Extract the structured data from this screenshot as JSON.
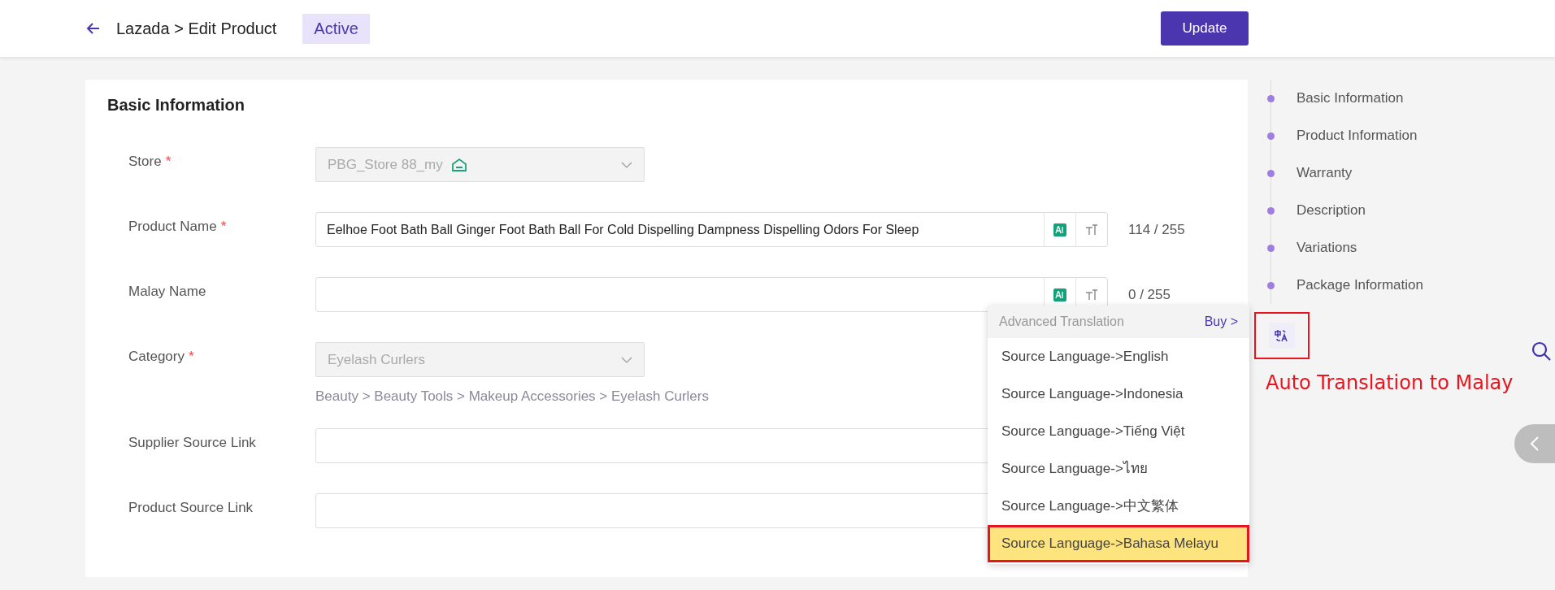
{
  "header": {
    "breadcrumb": "Lazada > Edit Product",
    "status": "Active",
    "update_button": "Update"
  },
  "section": {
    "title": "Basic Information",
    "fields": [
      {
        "kind": "select",
        "label": "Store",
        "required_mark": "*",
        "value": "PBG_Store 88_my",
        "store_icon": true
      },
      {
        "kind": "text",
        "label": "Product Name",
        "required_mark": "*",
        "value": "Eelhoe Foot Bath Ball Ginger Foot Bath Ball For Cold Dispelling Dampness Dispelling Odors For Sleep",
        "counter": "114 / 255"
      },
      {
        "kind": "text",
        "label": "Malay Name",
        "counter": "0 / 255"
      },
      {
        "kind": "select",
        "label": "Category",
        "required_mark": "*",
        "value": "Eyelash Curlers",
        "hint": "Beauty > Beauty Tools > Makeup Accessories > Eyelash Curlers"
      },
      {
        "kind": "link",
        "label": "Supplier Source Link"
      },
      {
        "kind": "link",
        "label": "Product Source Link"
      }
    ]
  },
  "translation_menu": {
    "open": true,
    "title": "Advanced Translation",
    "buy_link": "Buy >",
    "items": [
      {
        "label": "Source Language->English",
        "selected": false
      },
      {
        "label": "Source Language->Indonesia",
        "selected": false
      },
      {
        "label": "Source Language->Tiếng Việt",
        "selected": false
      },
      {
        "label": "Source Language->ไทย",
        "selected": false
      },
      {
        "label": "Source Language->中文繁体",
        "selected": false
      },
      {
        "label": "Source Language->Bahasa Melayu",
        "selected": true
      }
    ]
  },
  "outline": {
    "items": [
      "Basic Information",
      "Product Information",
      "Warranty",
      "Description",
      "Variations",
      "Package Information"
    ]
  },
  "translate_button": {
    "highlighted": true
  },
  "annotation": "Auto Translation to Malay"
}
